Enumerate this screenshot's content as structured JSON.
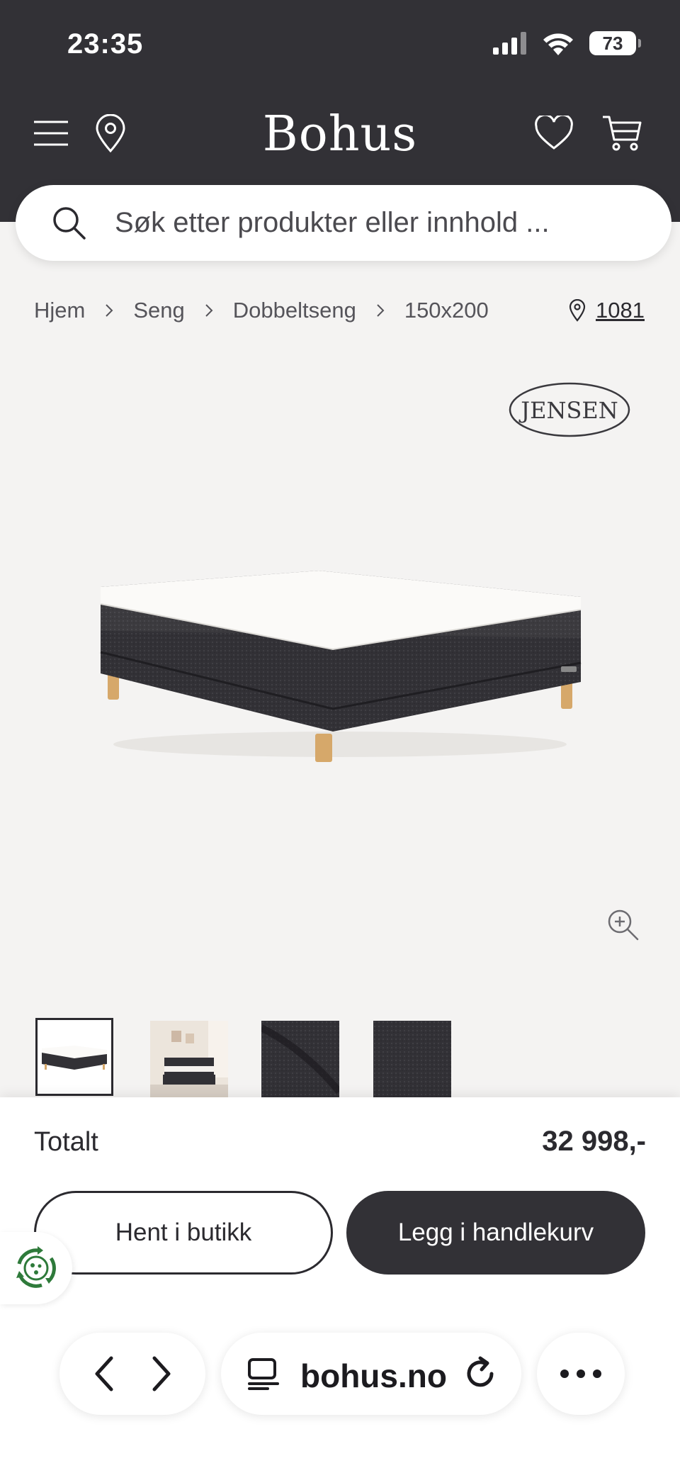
{
  "status_bar": {
    "time": "23:35",
    "battery": "73"
  },
  "header": {
    "logo": "Bohus"
  },
  "search": {
    "placeholder": "Søk etter produkter eller innhold ..."
  },
  "breadcrumb": [
    "Hjem",
    "Seng",
    "Dobbeltseng",
    "150x200"
  ],
  "store": {
    "number": "1081"
  },
  "brand": {
    "name": "JENSEN"
  },
  "checkout": {
    "total_label": "Totalt",
    "total_price": "32 998,-",
    "pickup_button": "Hent i butikk",
    "cart_button": "Legg i handlekurv"
  },
  "browser": {
    "url": "bohus.no"
  },
  "colors": {
    "header_bg": "#323136",
    "page_bg": "#f4f3f2",
    "accent_dark": "#323136",
    "eco_green": "#2e7a3a"
  }
}
